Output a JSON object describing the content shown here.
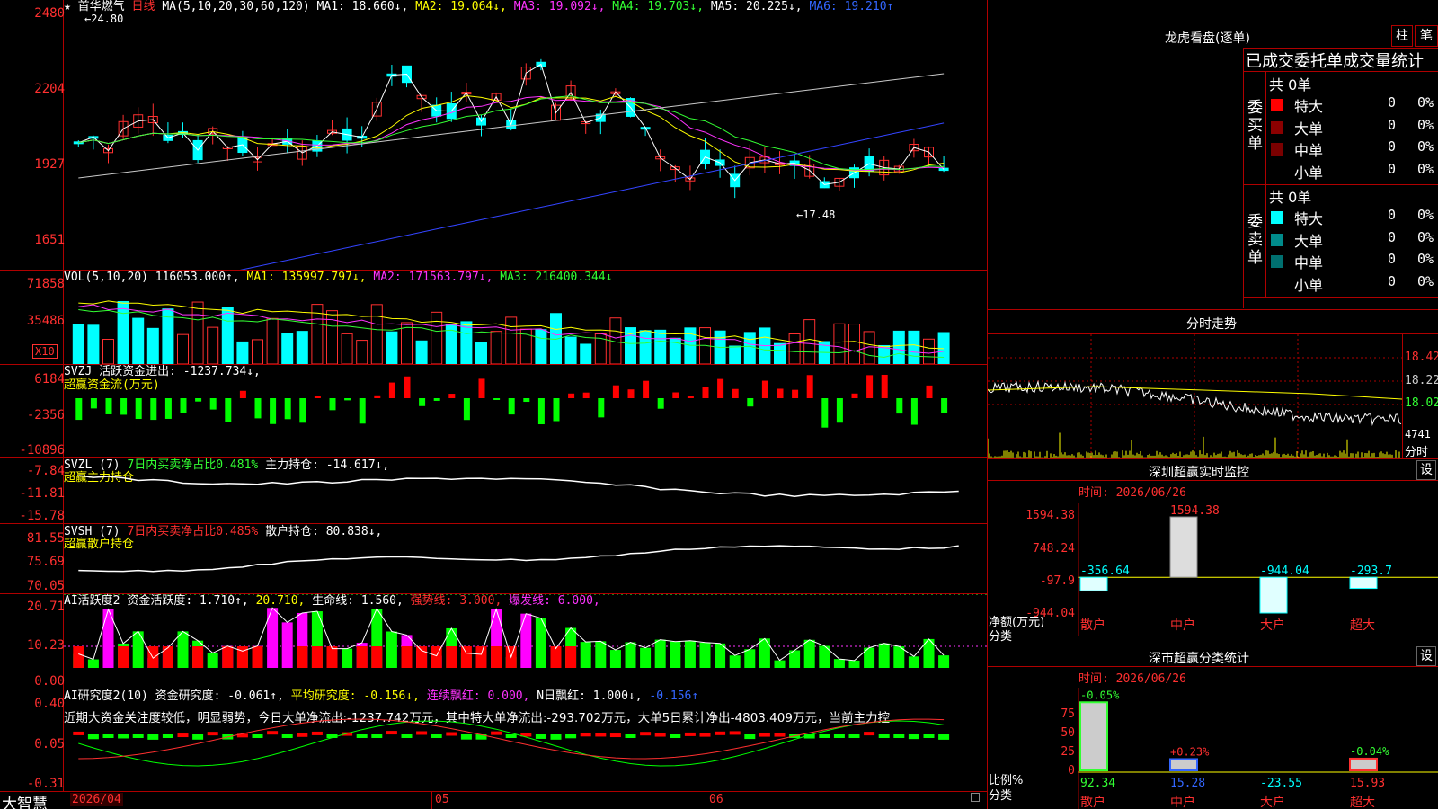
{
  "colors": {
    "up": "#ff3030",
    "down": "#00ffff",
    "ma1": "#ffffff",
    "ma2": "#ffff00",
    "ma3": "#ff33ff",
    "ma4": "#33ff33",
    "ma5": "#c8c8c8",
    "ma6": "#3344ff",
    "grid": "#b00000"
  },
  "price_panel": {
    "star": "★",
    "stock_name": "首华燃气",
    "period": "日线",
    "ma_label": "MA(5,10,20,30,60,120)",
    "ma1": "MA1: 18.660↓,",
    "ma2": "MA2: 19.064↓,",
    "ma3": "MA3: 19.092↓,",
    "ma4": "MA4: 19.703↓,",
    "ma5": "MA5: 20.225↓,",
    "ma6": "MA6: 19.210↑",
    "high_marker": "←24.80",
    "low_marker": "←17.48",
    "y_ticks": [
      "2480",
      "2204",
      "1927",
      "1651"
    ]
  },
  "vol_panel": {
    "label": "VOL(5,10,20)",
    "value": "116053.000↑,",
    "ma1": "MA1: 135997.797↓,",
    "ma2": "MA2: 171563.797↓,",
    "ma3": "MA3: 216400.344↓",
    "y_ticks": [
      "71858",
      "35486"
    ],
    "unit": "X10"
  },
  "svzj_panel": {
    "label": "SVZJ",
    "text": "活跃资金进出: -1237.734↓,",
    "title": "超赢资金流(万元)",
    "y_ticks": [
      "6184",
      "-2356",
      "-10896"
    ]
  },
  "svzl_panel": {
    "label": "SVZL (7)",
    "t1": "7日内买卖净占比0.481%",
    "t2": "主力持仓: -14.617↓,",
    "title": "超赢主力持仓",
    "y_ticks": [
      "-7.84",
      "-11.81",
      "-15.78"
    ]
  },
  "svsh_panel": {
    "label": "SVSH (7)",
    "t1": "7日内买卖净占比0.485%",
    "t2": "散户持仓: 80.838↓,",
    "title": "超赢散户持仓",
    "y_ticks": [
      "81.55",
      "75.69",
      "70.05"
    ]
  },
  "ai1_panel": {
    "label": "AI活跃度2",
    "t1": "资金活跃度: 1.710↑,",
    "t2": "20.710,",
    "t3": "生命线: 1.560,",
    "t4": "强势线: 3.000,",
    "t5": "爆发线: 6.000,",
    "y_ticks": [
      "20.71",
      "10.23",
      "0.00"
    ]
  },
  "ai2_panel": {
    "label": "AI研究度2(10)",
    "t1": "资金研究度: -0.061↑,",
    "t2": "平均研究度: -0.156↓,",
    "t3": "连续飘红: 0.000,",
    "t4": "N日飘红: 1.000↓,",
    "t5": "-0.156↑",
    "comment": "近期大资金关注度较低，明显弱势，今日大单净流出:-1237.742万元，其中特大单净流出:-293.702万元，大单5日累计净出-4803.409万元，当前主力控",
    "y_ticks": [
      "0.40",
      "0.05",
      "-0.31"
    ]
  },
  "bottom_axis": {
    "brand": "大智慧",
    "d1": "2026/04",
    "d2": "05",
    "d3": "06"
  },
  "dragon": {
    "title": "龙虎看盘(逐单)",
    "btn1": "柱",
    "btn2": "笔",
    "header": "已成交委托单成交量统计",
    "buy": {
      "side": "委买单",
      "total": "共 0单",
      "rows": [
        {
          "name": "特大",
          "v": "0",
          "p": "0%",
          "c": "#ff0000"
        },
        {
          "name": "大单",
          "v": "0",
          "p": "0%",
          "c": "#8b0000"
        },
        {
          "name": "中单",
          "v": "0",
          "p": "0%",
          "c": "#7a0000"
        },
        {
          "name": "小单",
          "v": "0",
          "p": "0%",
          "c": "#000000"
        }
      ]
    },
    "sell": {
      "side": "委卖单",
      "total": "共 0单",
      "rows": [
        {
          "name": "特大",
          "v": "0",
          "p": "0%",
          "c": "#00ffff"
        },
        {
          "name": "大单",
          "v": "0",
          "p": "0%",
          "c": "#008b8b"
        },
        {
          "name": "中单",
          "v": "0",
          "p": "0%",
          "c": "#007070"
        },
        {
          "name": "小单",
          "v": "0",
          "p": "0%",
          "c": "#000000"
        }
      ]
    }
  },
  "intraday": {
    "title": "分时走势",
    "y_ticks": [
      "18.42",
      "18.22",
      "18.02"
    ],
    "vol": "4741",
    "label": "分时"
  },
  "sz_monitor": {
    "title": "深圳超赢实时监控",
    "btn": "设",
    "time": "时间: 2026/06/26",
    "y_ticks": [
      "1594.38",
      "748.24",
      "-97.9",
      "-944.04"
    ],
    "footer1": "净额(万元)",
    "footer2": "分类",
    "bars": [
      {
        "cat": "散户",
        "value": -356.64,
        "label": "-356.64"
      },
      {
        "cat": "中户",
        "value": 1594.38,
        "label": "1594.38"
      },
      {
        "cat": "大户",
        "value": -944.04,
        "label": "-944.04"
      },
      {
        "cat": "超大",
        "value": -293.7,
        "label": "-293.7"
      }
    ]
  },
  "sz_stats": {
    "title": "深市超赢分类统计",
    "btn": "设",
    "time": "时间: 2026/06/26",
    "y_ticks": [
      "75",
      "50",
      "25",
      "0"
    ],
    "footer1": "比例%",
    "footer2": "分类",
    "cats": [
      {
        "cat": "散户",
        "top": "-0.05%",
        "bottom": "92.34",
        "pct": 92.34
      },
      {
        "cat": "中户",
        "top": "+0.23%",
        "bottom": "15.28",
        "pct": 15.28
      },
      {
        "cat": "大户",
        "top": "",
        "bottom": "-23.55",
        "pct": 0
      },
      {
        "cat": "超大",
        "top": "-0.04%",
        "bottom": "15.93",
        "pct": 15.93
      }
    ]
  }
}
